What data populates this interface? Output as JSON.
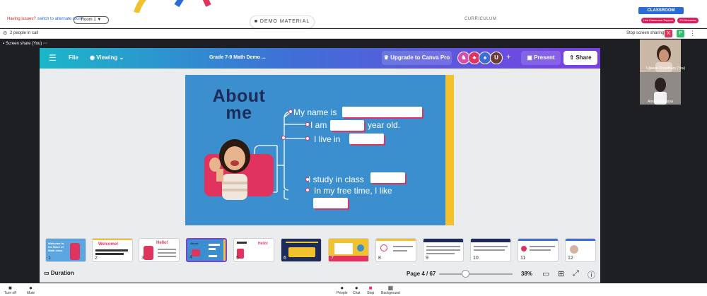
{
  "top": {
    "issue_text": "Having issues?",
    "alt_room_link": "switch to alternate room",
    "room_select": "Room 1",
    "demo_button": "DEMO MATERIAL",
    "curriculum_label": "CURRICULUM",
    "classroom_tab": "CLASSROOM",
    "support_pill": "Live Classroom Support",
    "moments_pill": "PS Moments"
  },
  "call": {
    "people_count": "2 people in call",
    "stop_sharing": "Stop screen sharing",
    "stop_x": "X",
    "p_badge": "P"
  },
  "screen_share_label": "Screen share (You)",
  "canva": {
    "file": "File",
    "viewing": "Viewing",
    "doc_title": "Grade 7-9 Math Demo ...",
    "upgrade": "Upgrade to Canva Pro",
    "avatar_u": "U",
    "present": "Present",
    "share": "Share",
    "duration": "Duration",
    "page": "Page 4 / 67",
    "zoom": "38%",
    "zoom_level": 0.38
  },
  "slide": {
    "title_line1": "About",
    "title_line2": "me",
    "line1": "My name is",
    "line2a": "I am",
    "line2b": "year old.",
    "line3": "I live in",
    "line4": "I study in class",
    "line5": "In my free time, I like"
  },
  "thumbnails": {
    "numbers": [
      "1",
      "2",
      "3",
      "4",
      "5",
      "6",
      "7",
      "8",
      "9",
      "10",
      "11",
      "12"
    ],
    "t1_text": "Welcome to the Maze of Math class",
    "t2_title": "Welcome!",
    "t3_title": "Hello!",
    "t5_title": "Hello!"
  },
  "participants": {
    "p1": "Ujjawal Choudhary (You)",
    "p2": "Anshika Maurya"
  },
  "toolbar": {
    "turn_off": "Turn off",
    "mute": "Mute",
    "people": "People",
    "chat": "Chat",
    "stop": "Stop",
    "background": "Background"
  },
  "colors": {
    "canva_gradient_start": "#1bb7c8",
    "canva_gradient_end": "#7b3fe4",
    "slide_bg": "#3b8fcf",
    "accent_pink": "#e0335e",
    "accent_yellow": "#f2c12e",
    "title_navy": "#1c2b5a"
  }
}
